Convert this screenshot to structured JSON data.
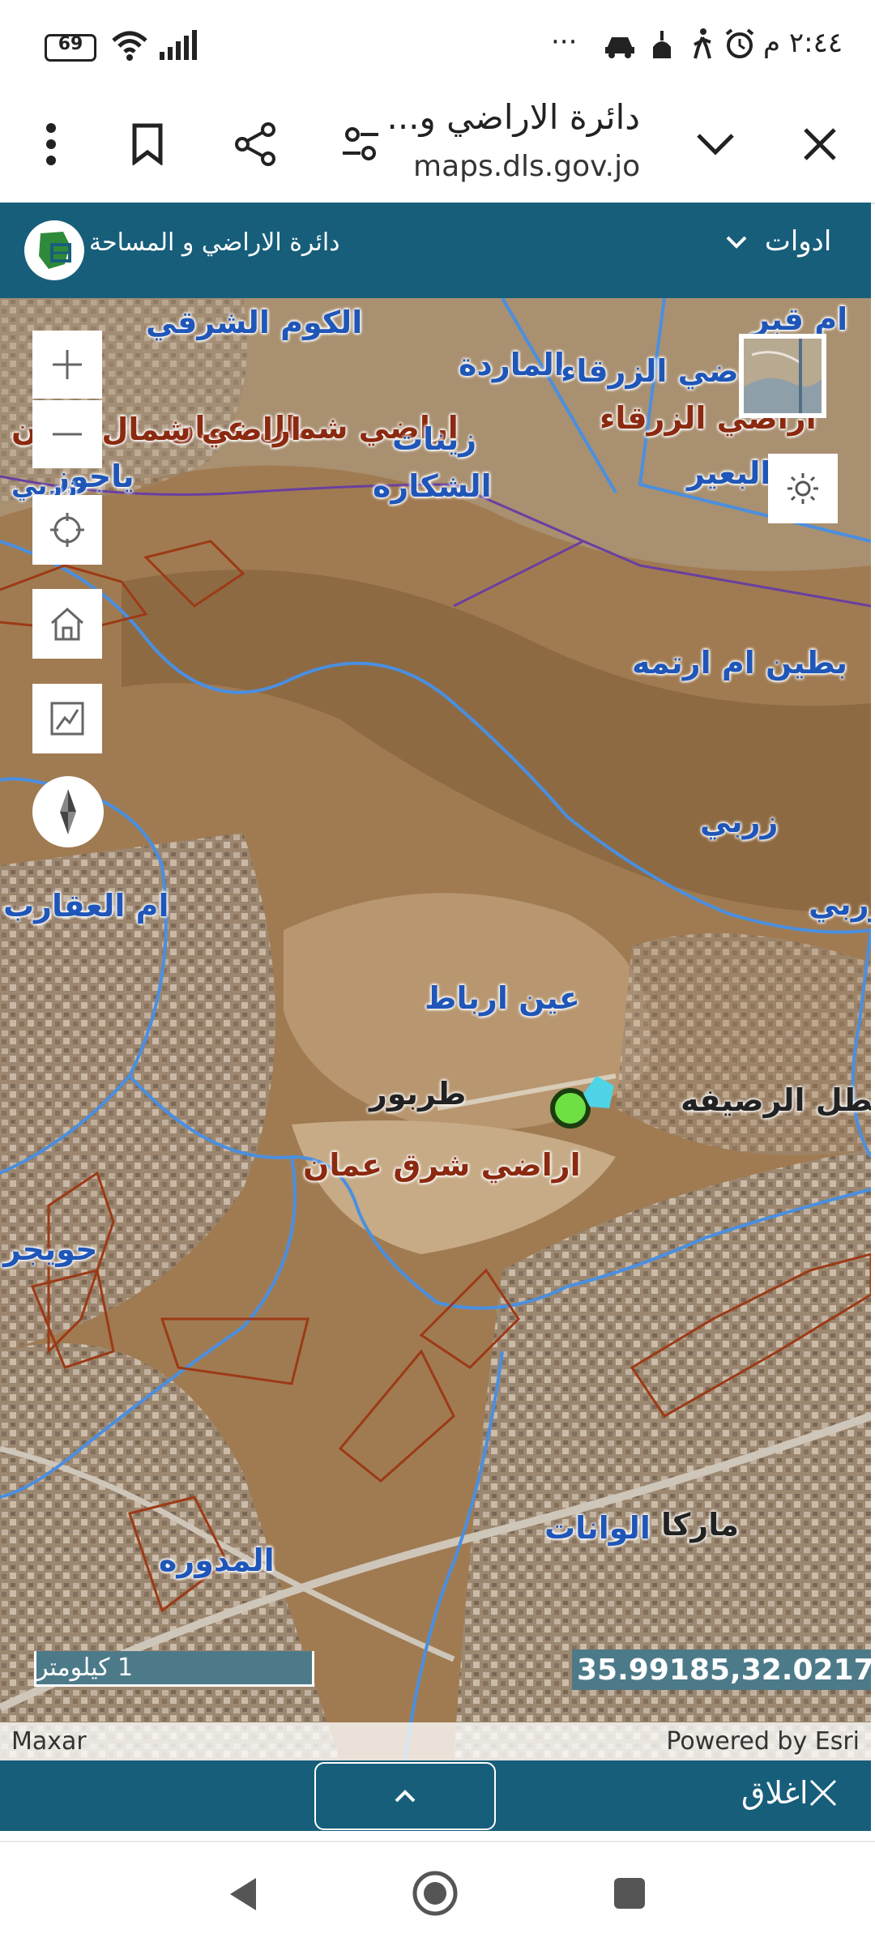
{
  "status_bar": {
    "time": "٢:٤٤ م",
    "battery": "69",
    "more": "···"
  },
  "browser": {
    "title": "دائرة الاراضي و...",
    "url": "maps.dls.gov.jo"
  },
  "app_header": {
    "brand": "دائرة الاراضي و المساحة",
    "tools": "ادوات"
  },
  "map": {
    "labels_blue": [
      "الكوم الشرقي",
      "ام قبر",
      "الماردة",
      "اراضي الزرقاء",
      "زينات",
      "الشكاره",
      "ياجوز",
      "زربي",
      "البعير",
      "بطين ام ارتمه",
      "زربي",
      "زربي",
      "ام العقارب",
      "عين ارباط",
      "طربور",
      "عطل الرصيفه",
      "حويجر",
      "الوانات",
      "ماركا",
      "المدوره"
    ],
    "labels_red": [
      "اراضي شمال عمان",
      "اراضي شمال عمان",
      "اراضي الزرقاء",
      "اراضي شرق عمان"
    ],
    "scale": "1 كيلومتر",
    "coordinates": "35.99185,32.02170",
    "attribution_left": "Maxar",
    "attribution_right": "Powered by Esri"
  },
  "bottom_panel": {
    "close_label": "اغلاق"
  },
  "colors": {
    "header": "#175e7a",
    "boundary_blue": "#4a8fe0",
    "boundary_red": "#9c3a16"
  }
}
